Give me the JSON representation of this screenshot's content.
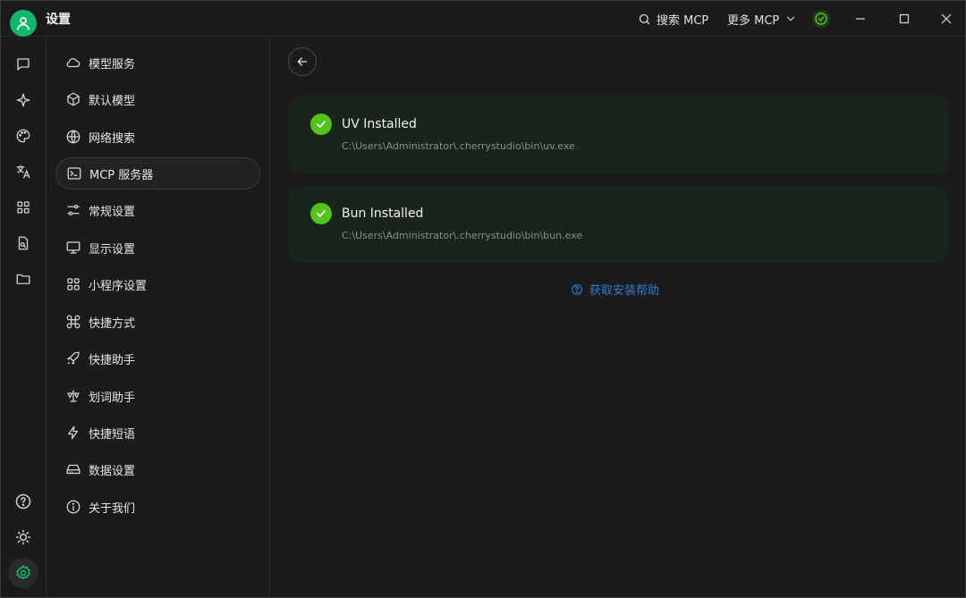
{
  "app": {
    "title": "设置"
  },
  "header": {
    "search_label": "搜索 MCP",
    "more_label": "更多 MCP"
  },
  "menu": {
    "items": [
      {
        "label": "模型服务",
        "icon": "cloud-icon"
      },
      {
        "label": "默认模型",
        "icon": "cube-icon"
      },
      {
        "label": "网络搜索",
        "icon": "globe-icon"
      },
      {
        "label": "MCP 服务器",
        "icon": "terminal-icon",
        "active": true
      },
      {
        "label": "常规设置",
        "icon": "sliders-icon"
      },
      {
        "label": "显示设置",
        "icon": "monitor-icon"
      },
      {
        "label": "小程序设置",
        "icon": "grid-icon"
      },
      {
        "label": "快捷方式",
        "icon": "command-icon"
      },
      {
        "label": "快捷助手",
        "icon": "rocket-icon"
      },
      {
        "label": "划词助手",
        "icon": "text-select-icon"
      },
      {
        "label": "快捷短语",
        "icon": "zap-icon"
      },
      {
        "label": "数据设置",
        "icon": "hard-drive-icon"
      },
      {
        "label": "关于我们",
        "icon": "info-icon"
      }
    ]
  },
  "content": {
    "cards": [
      {
        "title": "UV Installed",
        "path": "C:\\Users\\Administrator\\.cherrystudio\\bin\\uv.exe"
      },
      {
        "title": "Bun Installed",
        "path": "C:\\Users\\Administrator\\.cherrystudio\\bin\\bun.exe"
      }
    ],
    "help_label": "获取安装帮助"
  },
  "colors": {
    "accent_green": "#52c41a",
    "link_blue": "#2f7dd6",
    "card_bg": "#19241a",
    "avatar_green": "#12b76a"
  }
}
